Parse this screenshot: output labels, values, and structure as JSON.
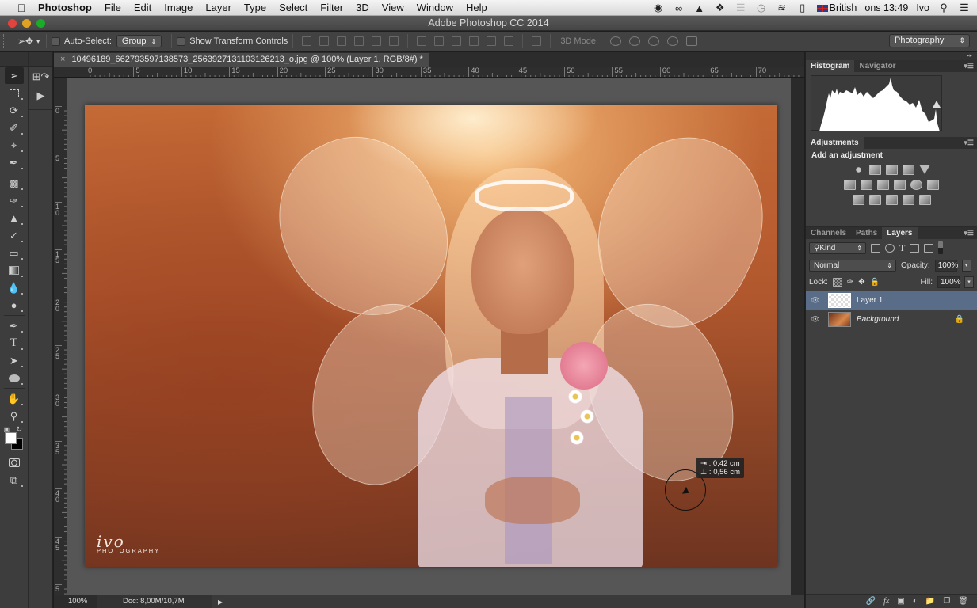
{
  "menubar": {
    "app_name": "Photoshop",
    "items": [
      "File",
      "Edit",
      "Image",
      "Layer",
      "Type",
      "Select",
      "Filter",
      "3D",
      "View",
      "Window",
      "Help"
    ],
    "status_icons": [
      "record-icon",
      "creative-cloud-icon",
      "google-drive-icon",
      "dropbox-icon",
      "bars-icon",
      "time-machine-icon",
      "wifi-icon",
      "battery-icon"
    ],
    "input_source": "British",
    "clock": "ons 13:49",
    "user": "Ivo"
  },
  "window": {
    "title": "Adobe Photoshop CC 2014"
  },
  "options_bar": {
    "auto_select_label": "Auto-Select:",
    "auto_select_checked": false,
    "auto_select_target": "Group",
    "show_transform_label": "Show Transform Controls",
    "show_transform_checked": false,
    "mode_3d_label": "3D Mode:",
    "workspace": "Photography"
  },
  "document": {
    "tab_title": "10496189_662793597138573_2563927131103126213_o.jpg @ 100% (Layer 1, RGB/8#) *",
    "h_ruler": [
      "0",
      "5",
      "10",
      "15",
      "20",
      "25",
      "30",
      "35",
      "40",
      "45",
      "50",
      "55",
      "60",
      "65",
      "70"
    ],
    "v_ruler": [
      "0",
      "5",
      "10",
      "15",
      "20",
      "25",
      "30",
      "35",
      "40",
      "45",
      "5"
    ],
    "measure_tooltip": {
      "dx": "0,42 cm",
      "dy": "0,56 cm"
    },
    "watermark": {
      "script": "ivo",
      "sub": "PHOTOGRAPHY"
    },
    "status": {
      "zoom": "100%",
      "doc_size": "Doc: 8,00M/10,7M"
    }
  },
  "tools": [
    "move-tool",
    "marquee-tool",
    "lasso-tool",
    "quick-selection-tool",
    "crop-tool",
    "eyedropper-tool",
    "healing-brush-tool",
    "brush-tool",
    "clone-stamp-tool",
    "history-brush-tool",
    "eraser-tool",
    "gradient-tool",
    "blur-tool",
    "dodge-tool",
    "pen-tool",
    "type-tool",
    "path-selection-tool",
    "ellipse-tool",
    "hand-tool",
    "zoom-tool"
  ],
  "colors": {
    "foreground": "#ffffff",
    "background": "#000000"
  },
  "panels": {
    "histogram_tabs": [
      "Histogram",
      "Navigator"
    ],
    "adjustments_tab": "Adjustments",
    "adjustments_title": "Add an adjustment",
    "adjustment_rows": [
      [
        "brightness-contrast-icon",
        "levels-icon",
        "curves-icon",
        "exposure-icon",
        "vibrance-icon"
      ],
      [
        "hue-saturation-icon",
        "color-balance-icon",
        "black-white-icon",
        "photo-filter-icon",
        "channel-mixer-icon",
        "color-lookup-icon"
      ],
      [
        "invert-icon",
        "posterize-icon",
        "threshold-icon",
        "selective-color-icon",
        "gradient-map-icon"
      ]
    ],
    "layers_tabs": [
      "Channels",
      "Paths",
      "Layers"
    ],
    "filter_kind": "Kind",
    "blend_mode": "Normal",
    "opacity_label": "Opacity:",
    "opacity": "100%",
    "lock_label": "Lock:",
    "fill_label": "Fill:",
    "fill": "100%",
    "layers": [
      {
        "name": "Layer 1",
        "visible": true,
        "selected": true,
        "locked": false
      },
      {
        "name": "Background",
        "visible": true,
        "selected": false,
        "locked": true
      }
    ]
  }
}
